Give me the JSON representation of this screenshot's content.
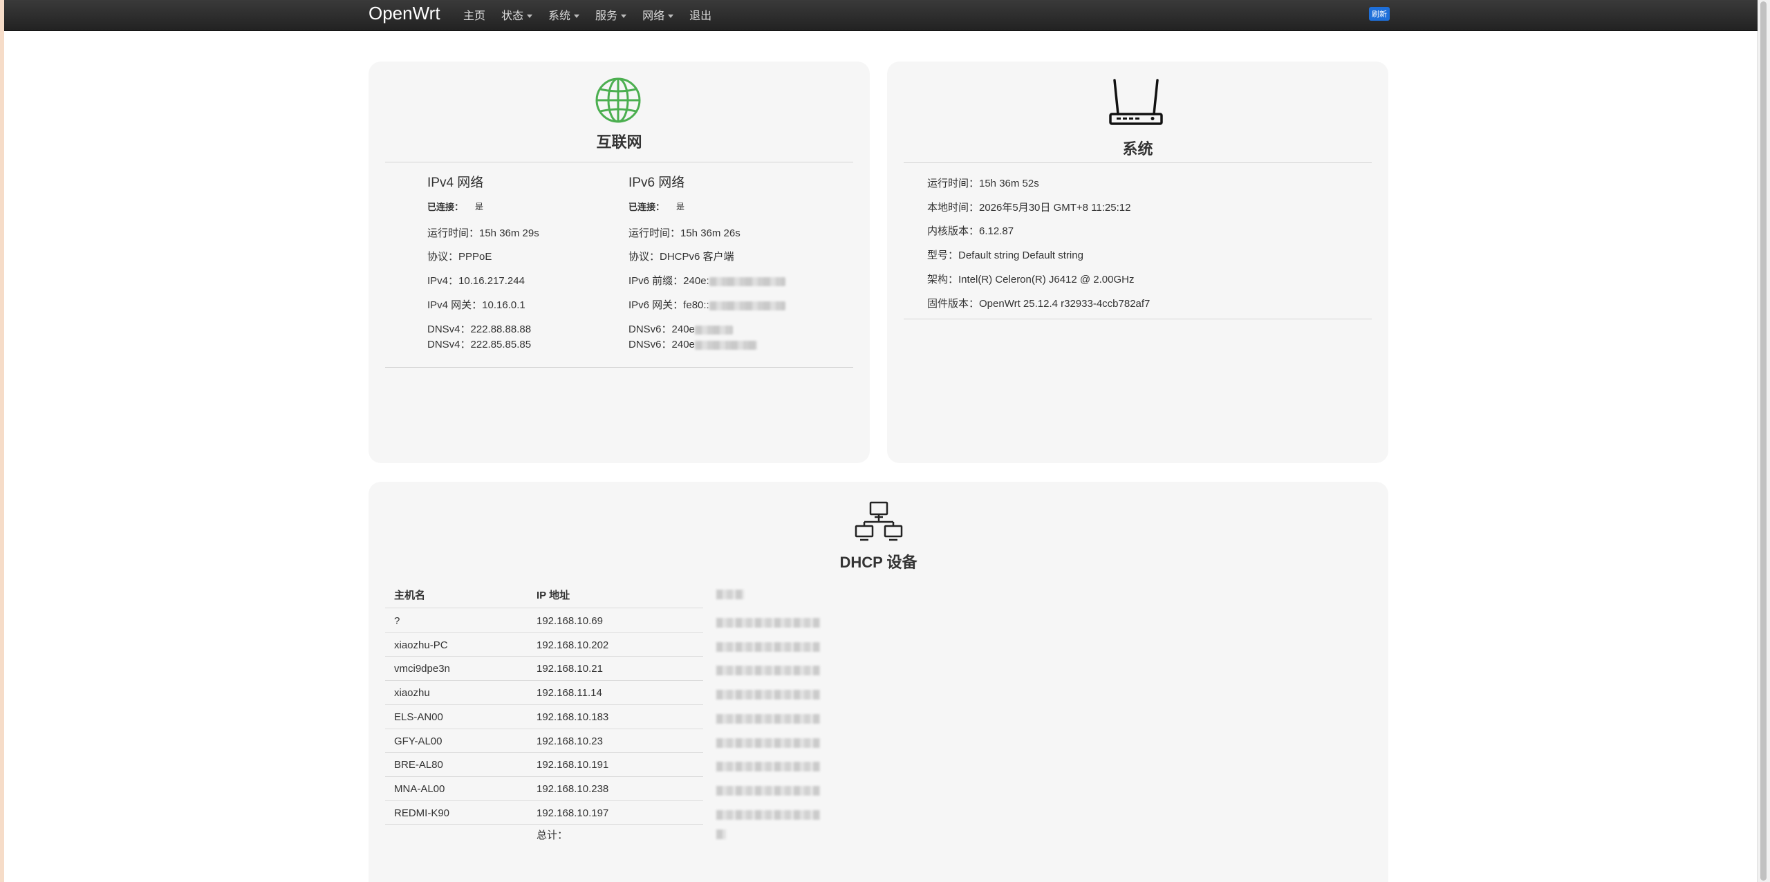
{
  "navbar": {
    "brand": "OpenWrt",
    "items": [
      {
        "label": "主页",
        "dropdown": false
      },
      {
        "label": "状态",
        "dropdown": true
      },
      {
        "label": "系统",
        "dropdown": true
      },
      {
        "label": "服务",
        "dropdown": true
      },
      {
        "label": "网络",
        "dropdown": true
      },
      {
        "label": "退出",
        "dropdown": false
      }
    ],
    "refresh": "刷新"
  },
  "internet": {
    "title": "互联网",
    "ipv4": {
      "heading": "IPv4 网络",
      "connected_label": "已连接：",
      "connected_value": "是",
      "uptime": "运行时间：15h 36m 29s",
      "protocol": "协议：PPPoE",
      "address": "IPv4：10.16.217.244",
      "gateway": "IPv4 网关：10.16.0.1",
      "dns1": "DNSv4：222.88.88.88",
      "dns2": "DNSv4：222.85.85.85"
    },
    "ipv6": {
      "heading": "IPv6 网络",
      "connected_label": "已连接：",
      "connected_value": "是",
      "uptime": "运行时间：15h 36m 26s",
      "protocol": "协议：DHCPv6 客户端",
      "prefix": "IPv6 前缀：240e:",
      "gateway": "IPv6 网关：fe80::",
      "dns1": "DNSv6：240e",
      "dns2": "DNSv6：240e"
    }
  },
  "system": {
    "title": "系统",
    "uptime": "运行时间：15h 36m 52s",
    "localtime": "本地时间：2026年5月30日 GMT+8 11:25:12",
    "kernel": "内核版本：6.12.87",
    "model": "型号：Default string Default string",
    "arch": "架构：Intel(R) Celeron(R) J6412 @ 2.00GHz",
    "firmware": "固件版本：OpenWrt 25.12.4 r32933-4ccb782af7"
  },
  "dhcp": {
    "title": "DHCP 设备",
    "headers": {
      "hostname": "主机名",
      "ip": "IP 地址"
    },
    "rows": [
      {
        "host": "?",
        "ip": "192.168.10.69"
      },
      {
        "host": "xiaozhu-PC",
        "ip": "192.168.10.202"
      },
      {
        "host": "vmci9dpe3n",
        "ip": "192.168.10.21"
      },
      {
        "host": "xiaozhu",
        "ip": "192.168.11.14"
      },
      {
        "host": "ELS-AN00",
        "ip": "192.168.10.183"
      },
      {
        "host": "GFY-AL00",
        "ip": "192.168.10.23"
      },
      {
        "host": "BRE-AL80",
        "ip": "192.168.10.191"
      },
      {
        "host": "MNA-AL00",
        "ip": "192.168.10.238"
      },
      {
        "host": "REDMI-K90",
        "ip": "192.168.10.197"
      }
    ],
    "total_label": "总计："
  },
  "colors": {
    "navbar": "#2b2b2b",
    "card": "#f6f6f6",
    "globe": "#4caf50",
    "refresh_badge": "#1e6fd9"
  },
  "icons": [
    "globe-icon",
    "router-icon",
    "network-icon"
  ]
}
